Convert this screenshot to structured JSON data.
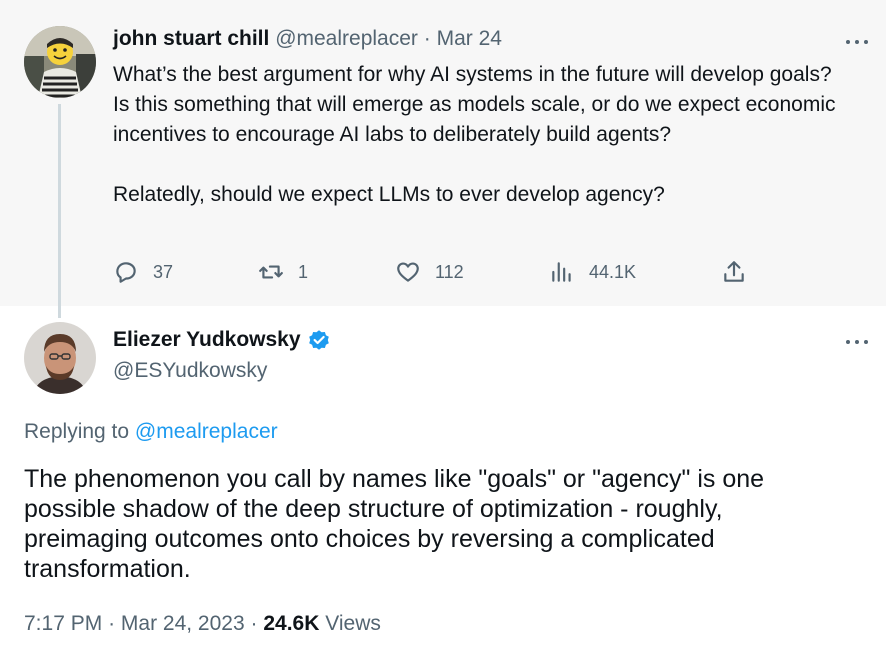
{
  "parent": {
    "name": "john stuart chill",
    "handle": "@mealreplacer",
    "separator": "·",
    "date": "Mar 24",
    "body_p1": "What’s the best argument for why AI systems in the future will develop goals?  Is this something that will emerge as models scale, or do we expect economic incentives to encourage AI labs to deliberately build agents?",
    "body_p2": "Relatedly, should we expect LLMs to ever develop agency?",
    "replies": "37",
    "retweets": "1",
    "likes": "112",
    "views": "44.1K"
  },
  "main": {
    "name": "Eliezer Yudkowsky",
    "handle": "@ESYudkowsky",
    "replying_prefix": "Replying to",
    "replying_to": "@mealreplacer",
    "text": "The phenomenon you call by names like \"goals\" or \"agency\" is one possible shadow of the deep structure of optimization - roughly, preimaging outcomes onto choices by reversing a complicated transformation.",
    "time": "7:17 PM",
    "separator": "·",
    "date": "Mar 24, 2023",
    "views_count": "24.6K",
    "views_label": "Views"
  },
  "colors": {
    "link": "#1d9bf0",
    "secondary_text": "#536471",
    "verified_badge": "#1d9bf0"
  },
  "icons": [
    "reply-icon",
    "retweet-icon",
    "like-icon",
    "views-icon",
    "share-icon",
    "more-icon",
    "verified-badge-icon"
  ]
}
